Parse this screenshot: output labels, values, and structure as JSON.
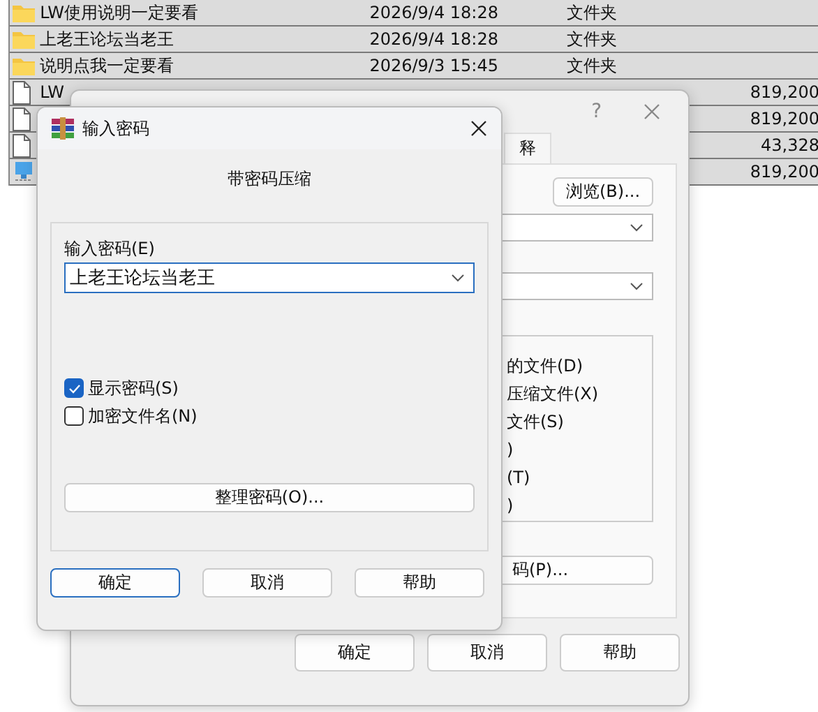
{
  "file_list": {
    "rows": [
      {
        "kind": "folder",
        "name": "LW使用说明一定要看",
        "date": "2026/9/4 18:28",
        "type": "文件夹",
        "size": ""
      },
      {
        "kind": "folder",
        "name": "上老王论坛当老王",
        "date": "2026/9/4 18:28",
        "type": "文件夹",
        "size": ""
      },
      {
        "kind": "folder",
        "name": "说明点我一定要看",
        "date": "2026/9/3 15:45",
        "type": "文件夹",
        "size": ""
      },
      {
        "kind": "file",
        "name": "LW",
        "date": "",
        "type": "",
        "size": "819,200"
      },
      {
        "kind": "file",
        "name": "",
        "date": "",
        "type": "",
        "size": "819,200"
      },
      {
        "kind": "file",
        "name": "",
        "date": "",
        "type": "",
        "size": "43,328"
      },
      {
        "kind": "network",
        "name": "",
        "date": "",
        "type": "",
        "size": "819,200"
      }
    ]
  },
  "archive_dialog": {
    "help": "?",
    "tab": "释",
    "browse_button": "浏览(B)...",
    "options": [
      "的文件(D)",
      "压缩文件(X)",
      "文件(S)",
      ")",
      "(T)",
      ")"
    ],
    "password_button": "码(P)...",
    "buttons": [
      "确定",
      "取消",
      "帮助"
    ]
  },
  "password_dialog": {
    "title": "输入密码",
    "heading": "带密码压缩",
    "password_label": "输入密码(E)",
    "password_value": "上老王论坛当老王",
    "checkboxes": [
      {
        "label": "显示密码(S)",
        "checked": true
      },
      {
        "label": "加密文件名(N)",
        "checked": false
      }
    ],
    "organize_button": "整理密码(O)...",
    "buttons": [
      {
        "label": "确定",
        "default": true
      },
      {
        "label": "取消",
        "default": false
      },
      {
        "label": "帮助",
        "default": false
      }
    ]
  }
}
